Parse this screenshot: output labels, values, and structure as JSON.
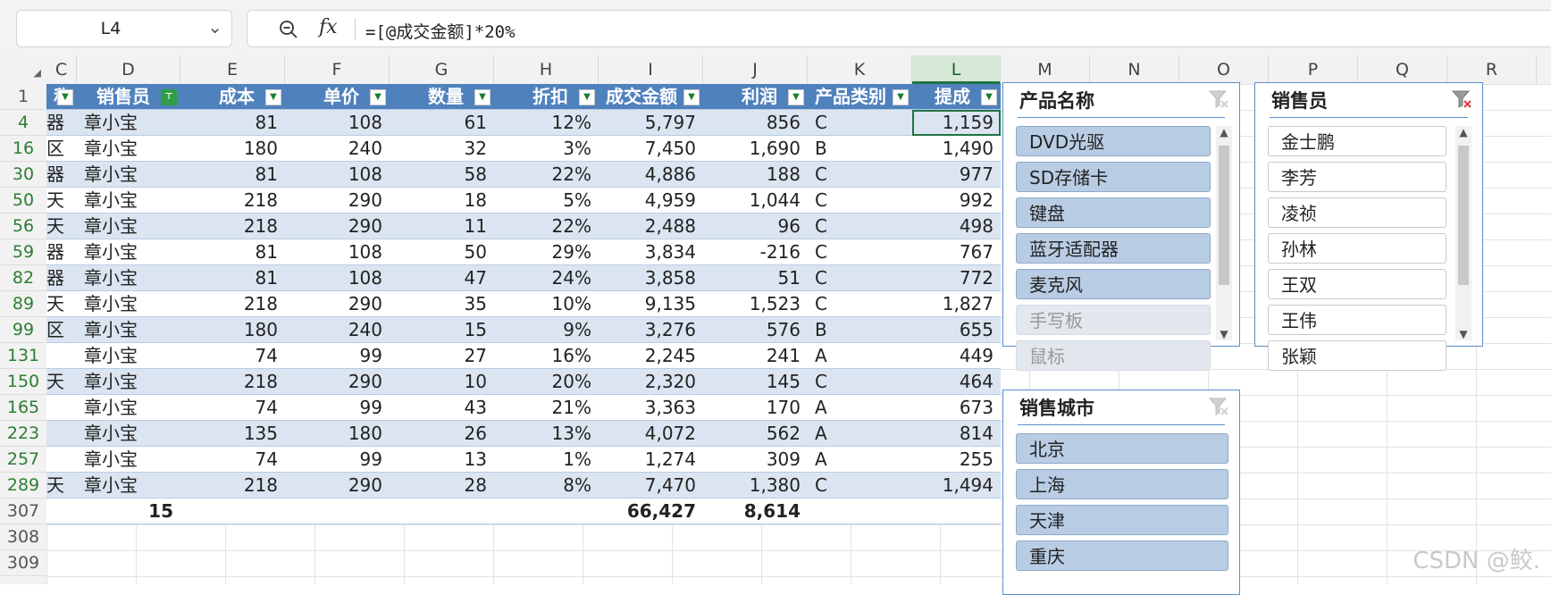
{
  "name_box": {
    "value": "L4"
  },
  "formula_bar": {
    "formula": "=[@成交金额]*20%"
  },
  "columns": [
    "C",
    "D",
    "E",
    "F",
    "G",
    "H",
    "I",
    "J",
    "K",
    "L",
    "M",
    "N",
    "O",
    "P",
    "Q",
    "R"
  ],
  "table": {
    "headers": [
      "称",
      "销售员",
      "成本",
      "单价",
      "数量",
      "折扣",
      "成交金额",
      "利润",
      "产品类别",
      "提成"
    ],
    "rows": [
      {
        "row": "4",
        "cells": [
          "器",
          "章小宝",
          "81",
          "108",
          "61",
          "12%",
          "5,797",
          "856",
          "C",
          "1,159"
        ]
      },
      {
        "row": "16",
        "cells": [
          "区",
          "章小宝",
          "180",
          "240",
          "32",
          "3%",
          "7,450",
          "1,690",
          "B",
          "1,490"
        ]
      },
      {
        "row": "30",
        "cells": [
          "器",
          "章小宝",
          "81",
          "108",
          "58",
          "22%",
          "4,886",
          "188",
          "C",
          "977"
        ]
      },
      {
        "row": "50",
        "cells": [
          "天",
          "章小宝",
          "218",
          "290",
          "18",
          "5%",
          "4,959",
          "1,044",
          "C",
          "992"
        ]
      },
      {
        "row": "56",
        "cells": [
          "天",
          "章小宝",
          "218",
          "290",
          "11",
          "22%",
          "2,488",
          "96",
          "C",
          "498"
        ]
      },
      {
        "row": "59",
        "cells": [
          "器",
          "章小宝",
          "81",
          "108",
          "50",
          "29%",
          "3,834",
          "-216",
          "C",
          "767"
        ]
      },
      {
        "row": "82",
        "cells": [
          "器",
          "章小宝",
          "81",
          "108",
          "47",
          "24%",
          "3,858",
          "51",
          "C",
          "772"
        ]
      },
      {
        "row": "89",
        "cells": [
          "天",
          "章小宝",
          "218",
          "290",
          "35",
          "10%",
          "9,135",
          "1,523",
          "C",
          "1,827"
        ]
      },
      {
        "row": "99",
        "cells": [
          "区",
          "章小宝",
          "180",
          "240",
          "15",
          "9%",
          "3,276",
          "576",
          "B",
          "655"
        ]
      },
      {
        "row": "131",
        "cells": [
          "",
          "章小宝",
          "74",
          "99",
          "27",
          "16%",
          "2,245",
          "241",
          "A",
          "449"
        ]
      },
      {
        "row": "150",
        "cells": [
          "天",
          "章小宝",
          "218",
          "290",
          "10",
          "20%",
          "2,320",
          "145",
          "C",
          "464"
        ]
      },
      {
        "row": "165",
        "cells": [
          "",
          "章小宝",
          "74",
          "99",
          "43",
          "21%",
          "3,363",
          "170",
          "A",
          "673"
        ]
      },
      {
        "row": "223",
        "cells": [
          "",
          "章小宝",
          "135",
          "180",
          "26",
          "13%",
          "4,072",
          "562",
          "A",
          "814"
        ]
      },
      {
        "row": "257",
        "cells": [
          "",
          "章小宝",
          "74",
          "99",
          "13",
          "1%",
          "1,274",
          "309",
          "A",
          "255"
        ]
      },
      {
        "row": "289",
        "cells": [
          "天",
          "章小宝",
          "218",
          "290",
          "28",
          "8%",
          "7,470",
          "1,380",
          "C",
          "1,494"
        ]
      }
    ],
    "total": {
      "row": "307",
      "cells": [
        "",
        "15",
        "",
        "",
        "",
        "",
        "66,427",
        "8,614",
        "",
        ""
      ]
    }
  },
  "extra_rows": [
    "308",
    "309"
  ],
  "slicers": {
    "product": {
      "title": "产品名称",
      "items": [
        {
          "label": "DVD光驱",
          "state": "on"
        },
        {
          "label": "SD存储卡",
          "state": "on"
        },
        {
          "label": "键盘",
          "state": "on"
        },
        {
          "label": "蓝牙适配器",
          "state": "on"
        },
        {
          "label": "麦克风",
          "state": "on"
        },
        {
          "label": "手写板",
          "state": "nodata"
        },
        {
          "label": "鼠标",
          "state": "nodata"
        }
      ]
    },
    "salesperson": {
      "title": "销售员",
      "items": [
        {
          "label": "金士鹏",
          "state": "off"
        },
        {
          "label": "李芳",
          "state": "off"
        },
        {
          "label": "凌祯",
          "state": "off"
        },
        {
          "label": "孙林",
          "state": "off"
        },
        {
          "label": "王双",
          "state": "off"
        },
        {
          "label": "王伟",
          "state": "off"
        },
        {
          "label": "张颖",
          "state": "off"
        }
      ]
    },
    "city": {
      "title": "销售城市",
      "items": [
        {
          "label": "北京",
          "state": "on"
        },
        {
          "label": "上海",
          "state": "on"
        },
        {
          "label": "天津",
          "state": "on"
        },
        {
          "label": "重庆",
          "state": "on"
        }
      ]
    }
  },
  "watermark": "CSDN @鲛.",
  "colors": {
    "header_blue": "#4f81bd",
    "band_blue": "#dbe5f1",
    "selection_green": "#217346"
  }
}
